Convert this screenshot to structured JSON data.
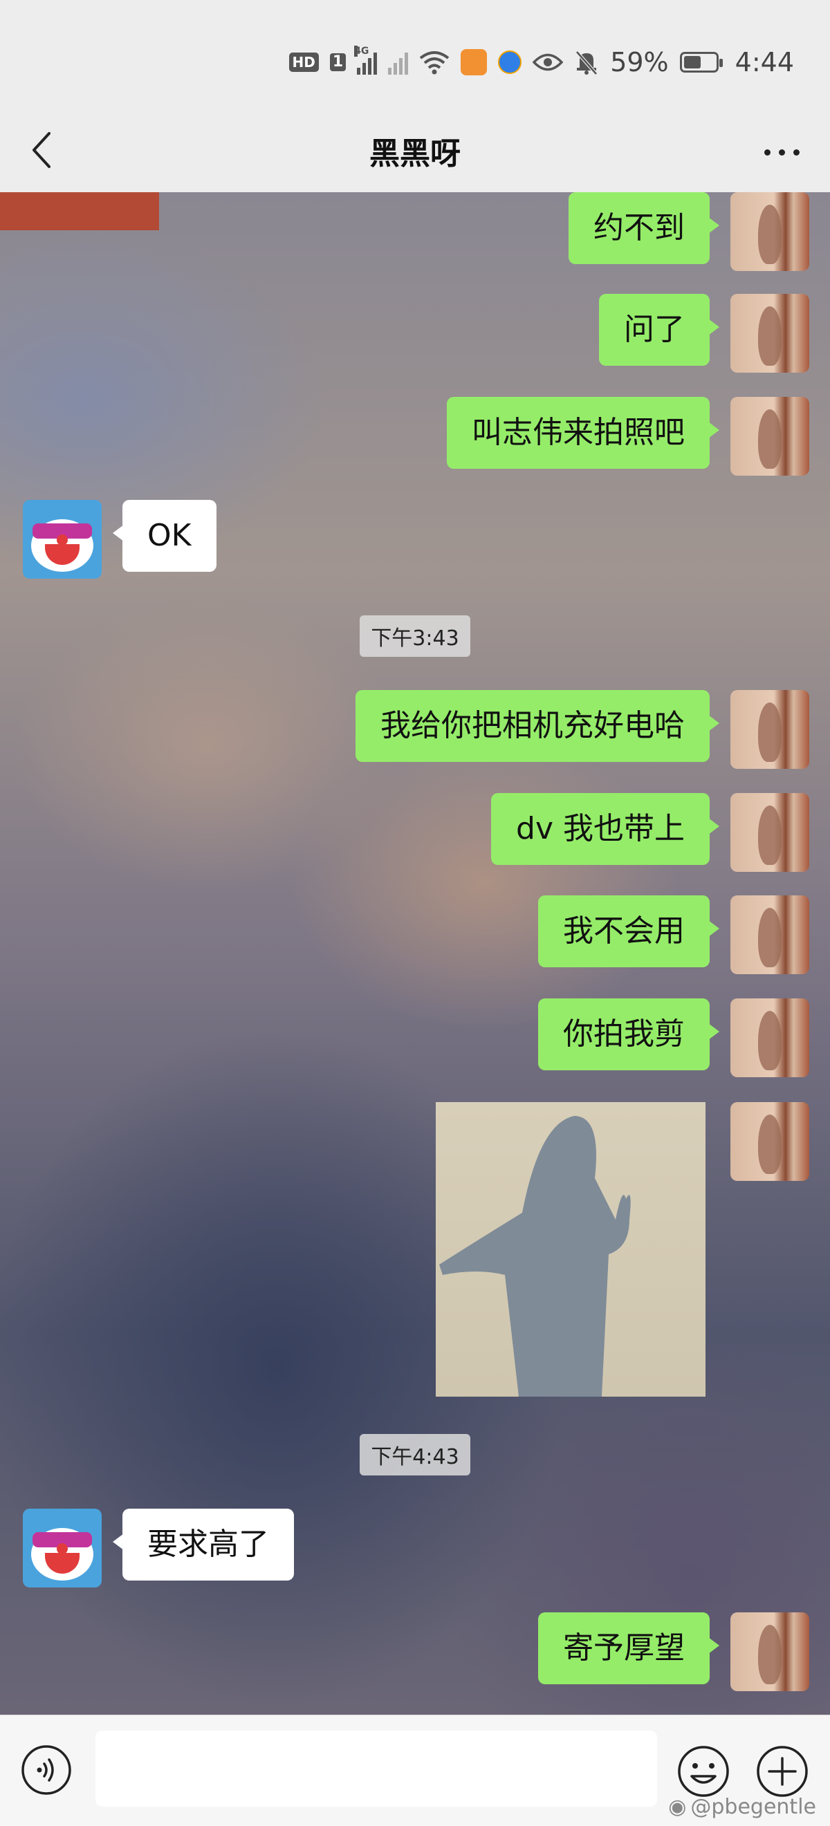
{
  "status_bar": {
    "hd_label": "HD",
    "sim_label": "1",
    "network_label": "4G",
    "battery_percent": "59%",
    "time": "4:44"
  },
  "header": {
    "title": "黑黑呀"
  },
  "messages": [
    {
      "side": "out",
      "text": "约不到"
    },
    {
      "side": "out",
      "text": "问了"
    },
    {
      "side": "out",
      "text": "叫志伟来拍照吧"
    },
    {
      "side": "in",
      "text": "OK"
    },
    {
      "type": "time",
      "text": "下午3:43"
    },
    {
      "side": "out",
      "text": "我给你把相机充好电哈"
    },
    {
      "side": "out",
      "text": "dv 我也带上"
    },
    {
      "side": "out",
      "text": "我不会用"
    },
    {
      "side": "out",
      "text": "你拍我剪"
    },
    {
      "side": "out",
      "type": "image"
    },
    {
      "type": "time",
      "text": "下午4:43"
    },
    {
      "side": "in",
      "text": "要求高了"
    },
    {
      "side": "out",
      "text": "寄予厚望"
    }
  ],
  "input": {
    "value": ""
  },
  "watermark": "@pbegentle",
  "colors": {
    "outgoing_bubble": "#95ec69",
    "incoming_bubble": "#ffffff",
    "background": "#ededed"
  }
}
